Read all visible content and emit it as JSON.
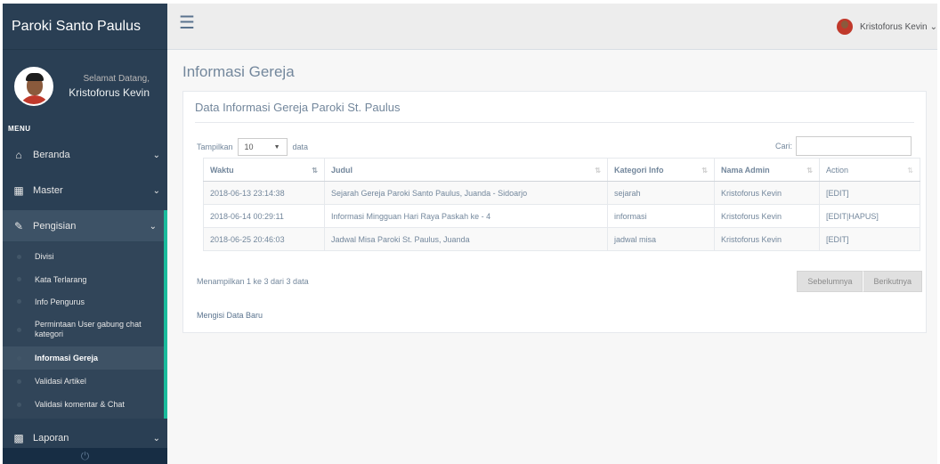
{
  "sidebar": {
    "brand": "Paroki Santo Paulus",
    "greeting": "Selamat Datang,",
    "user_name": "Kristoforus Kevin",
    "menu_label": "MENU",
    "nav": {
      "beranda": "Beranda",
      "master": "Master",
      "pengisian": "Pengisian",
      "laporan": "Laporan"
    },
    "submenu": [
      "Divisi",
      "Kata Terlarang",
      "Info Pengurus",
      "Permintaan User gabung chat kategori",
      "Informasi Gereja",
      "Validasi Artikel",
      "Validasi komentar & Chat"
    ],
    "footer_icon": "power-icon"
  },
  "topbar": {
    "menu_icon": "hamburger-icon",
    "user_name": "Kristoforus Kevin"
  },
  "main": {
    "page_title": "Informasi Gereja",
    "panel_title": "Data Informasi Gereja Paroki St. Paulus",
    "length": {
      "prefix": "Tampilkan",
      "value": "10",
      "suffix": "data"
    },
    "search_label": "Cari:",
    "table": {
      "headers": [
        "Waktu",
        "Judul",
        "Kategori Info",
        "Nama Admin",
        "Action"
      ],
      "rows": [
        [
          "2018-06-13 23:14:38",
          "Sejarah Gereja Paroki Santo Paulus, Juanda - Sidoarjo",
          "sejarah",
          "Kristoforus Kevin",
          "[EDIT]"
        ],
        [
          "2018-06-14 00:29:11",
          "Informasi Mingguan Hari Raya Paskah ke - 4",
          "informasi",
          "Kristoforus Kevin",
          "[EDIT|HAPUS]"
        ],
        [
          "2018-06-25 20:46:03",
          "Jadwal Misa Paroki St. Paulus, Juanda",
          "jadwal misa",
          "Kristoforus Kevin",
          "[EDIT]"
        ]
      ]
    },
    "info_text": "Menampilkan 1 ke 3 dari 3 data",
    "pager": {
      "prev": "Sebelumnya",
      "next": "Berikutnya"
    },
    "add_link": "Mengisi Data Baru"
  },
  "colors": {
    "sidebar_bg": "#2a3f54",
    "accent": "#1abb9c",
    "text": "#73879c"
  }
}
